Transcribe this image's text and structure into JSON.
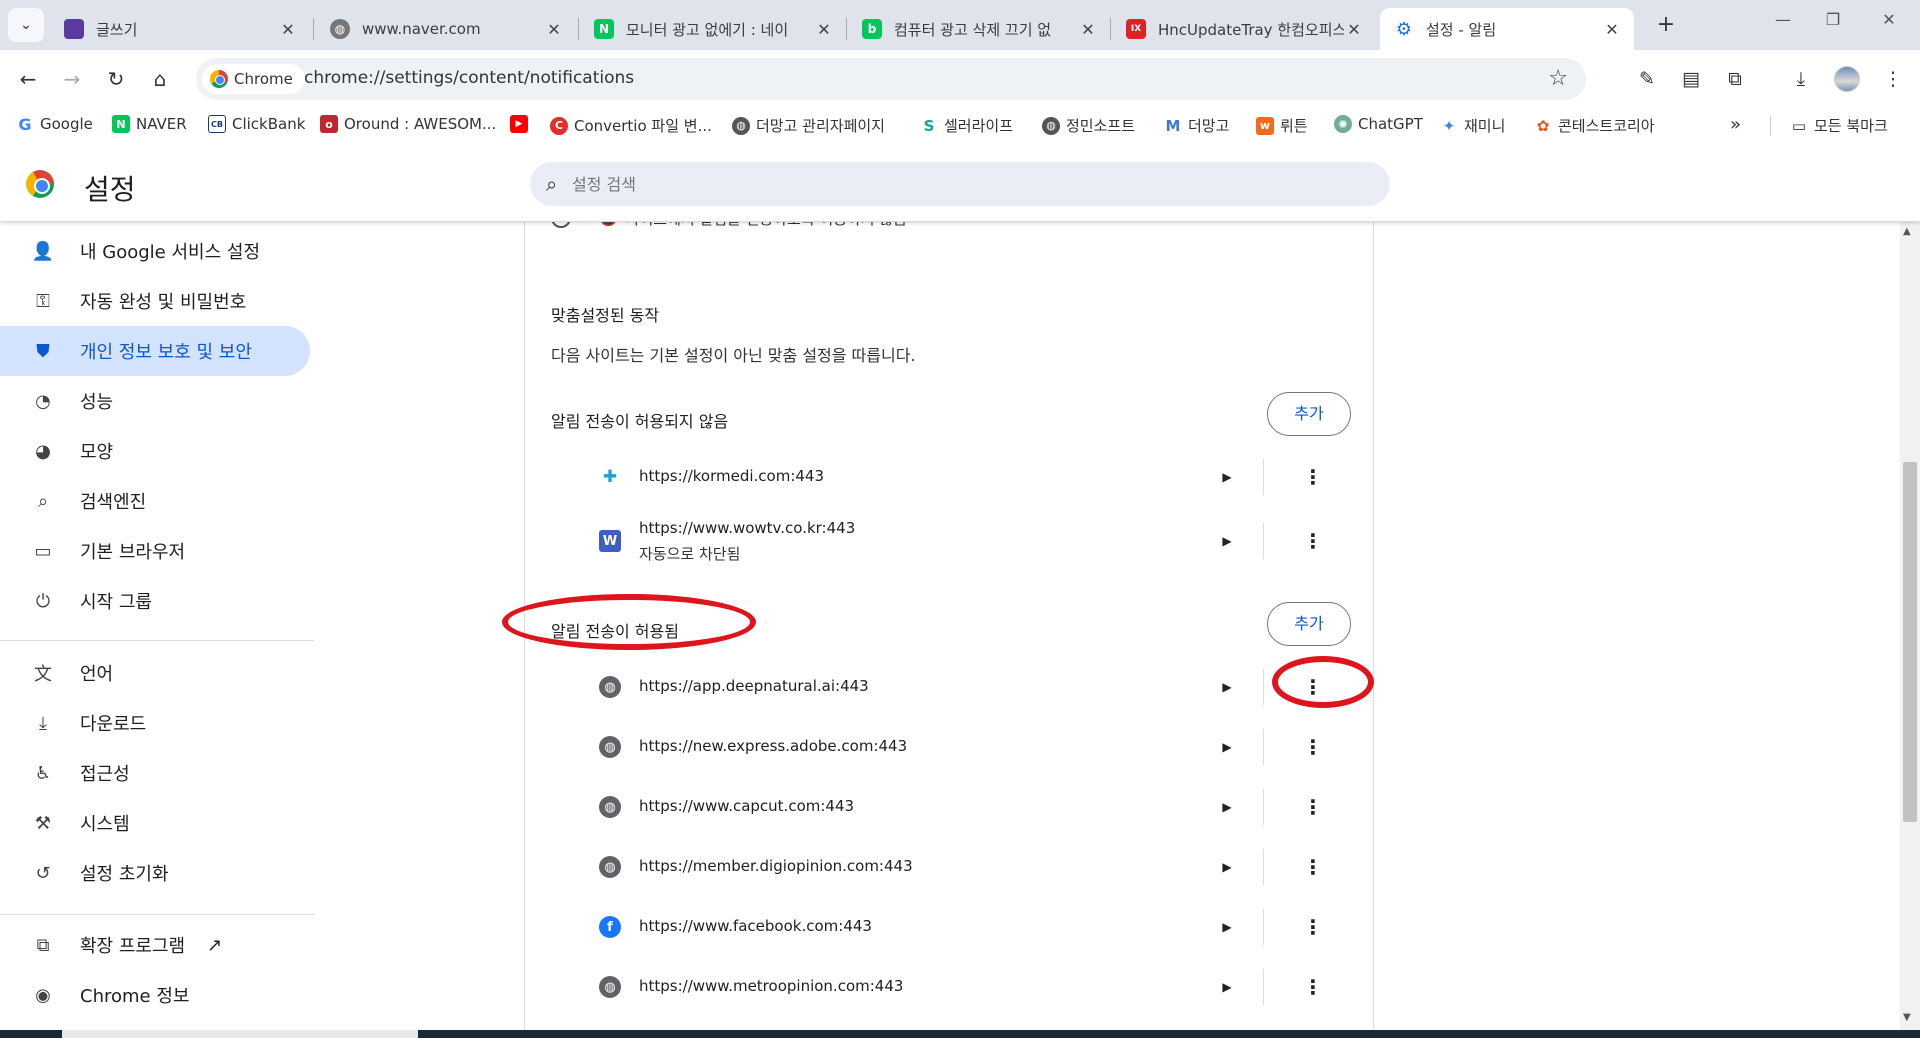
{
  "browser": {
    "tabs": [
      {
        "title": "글쓰기",
        "favicon_color": "#5b3c9e",
        "favicon_glyph": ""
      },
      {
        "title": "www.naver.com",
        "favicon_color": "#777777",
        "favicon_glyph": ""
      },
      {
        "title": "모니터 광고 없에기 : 네이",
        "favicon_color": "#03c75a",
        "favicon_glyph": "N"
      },
      {
        "title": "컴퓨터 광고 삭제 끄기 없",
        "favicon_color": "#03c75a",
        "favicon_glyph": "b"
      },
      {
        "title": "HncUpdateTray 한컴오피스",
        "favicon_color": "#e01f26",
        "favicon_glyph": "IX"
      },
      {
        "title": "설정 - 알림",
        "favicon_color": "#1a73e8",
        "favicon_glyph": "⚙"
      }
    ],
    "active_tab_index": 5,
    "chip_label": "Chrome",
    "url": "chrome://settings/content/notifications",
    "bookmarks": [
      {
        "label": "Google",
        "icon_color": "#ffffff",
        "glyph": "G",
        "glyph_color": "#4285f4"
      },
      {
        "label": "NAVER",
        "icon_color": "#03c75a",
        "glyph": "N",
        "glyph_color": "#ffffff"
      },
      {
        "label": "ClickBank",
        "icon_color": "#ffffff",
        "glyph": "CB",
        "glyph_color": "#1b3a6b"
      },
      {
        "label": "Oround : AWESOM...",
        "icon_color": "#c0272d",
        "glyph": "o",
        "glyph_color": "#ffffff"
      },
      {
        "label": "",
        "icon_color": "#ff0000",
        "glyph": "▶",
        "glyph_color": "#ffffff"
      },
      {
        "label": "Convertio 파일 변...",
        "icon_color": "#e22d28",
        "glyph": "C",
        "glyph_color": "#ffffff"
      },
      {
        "label": "더망고 관리자페이지",
        "icon_color": "#555555",
        "glyph": "◍",
        "glyph_color": "#ffffff"
      },
      {
        "label": "셀러라이프",
        "icon_color": "#ffffff",
        "glyph": "S",
        "glyph_color": "#15a38f"
      },
      {
        "label": "정민소프트",
        "icon_color": "#555555",
        "glyph": "◍",
        "glyph_color": "#ffffff"
      },
      {
        "label": "더망고",
        "icon_color": "#ffffff",
        "glyph": "M",
        "glyph_color": "#3a7bd5"
      },
      {
        "label": "뤼튼",
        "icon_color": "#f26b1d",
        "glyph": "w",
        "glyph_color": "#ffffff"
      },
      {
        "label": "ChatGPT",
        "icon_color": "#74aa9c",
        "glyph": "✺",
        "glyph_color": "#ffffff"
      },
      {
        "label": "재미니",
        "icon_color": "#ffffff",
        "glyph": "✦",
        "glyph_color": "#4a7cf0"
      },
      {
        "label": "콘테스트코리아",
        "icon_color": "#ffffff",
        "glyph": "✿",
        "glyph_color": "#e8521c"
      }
    ],
    "all_bookmarks_label": "모든 북마크"
  },
  "settings": {
    "title": "설정",
    "search_placeholder": "설정 검색",
    "nav": [
      {
        "label": "내 Google 서비스 설정",
        "icon": "person-icon",
        "glyph": "👤"
      },
      {
        "label": "자동 완성 및 비밀번호",
        "icon": "key-icon",
        "glyph": "⚿"
      },
      {
        "label": "개인 정보 보호 및 보안",
        "icon": "shield-icon",
        "glyph": "⛊"
      },
      {
        "label": "성능",
        "icon": "speedometer-icon",
        "glyph": "◔"
      },
      {
        "label": "모양",
        "icon": "palette-icon",
        "glyph": "◕"
      },
      {
        "label": "검색엔진",
        "icon": "search-icon",
        "glyph": "🔍"
      },
      {
        "label": "기본 브라우저",
        "icon": "browser-window-icon",
        "glyph": "▭"
      },
      {
        "label": "시작 그룹",
        "icon": "power-icon",
        "glyph": "⏻"
      },
      {
        "label": "언어",
        "icon": "translate-icon",
        "glyph": "文"
      },
      {
        "label": "다운로드",
        "icon": "download-icon",
        "glyph": "⤓"
      },
      {
        "label": "접근성",
        "icon": "accessibility-icon",
        "glyph": "♿"
      },
      {
        "label": "시스템",
        "icon": "wrench-icon",
        "glyph": "🔧"
      },
      {
        "label": "설정 초기화",
        "icon": "reset-icon",
        "glyph": "↺"
      },
      {
        "label": "확장 프로그램",
        "icon": "extension-icon",
        "glyph": "⧉"
      },
      {
        "label": "Chrome 정보",
        "icon": "chrome-icon",
        "glyph": "◉"
      }
    ],
    "active_nav_index": 2,
    "partial_text": "사이트에서 알림을 전송하도록 허용하지 않음",
    "custom_heading": "맞춤설정된 동작",
    "custom_subtext": "다음 사이트는 기본 설정이 아닌 맞춤 설정을 따릅니다.",
    "add_label": "추가",
    "blocked_heading": "알림 전송이 허용되지 않음",
    "blocked_sites": [
      {
        "url": "https://kormedi.com:443",
        "sub": "",
        "icon": "kormedi-icon",
        "icon_color": "#1fa3d6",
        "glyph": "K"
      },
      {
        "url": "https://www.wowtv.co.kr:443",
        "sub": "자동으로 차단됨",
        "icon": "wowtv-icon",
        "icon_color": "#3d5fc4",
        "glyph": "W"
      }
    ],
    "allowed_heading": "알림 전송이 허용됨",
    "allowed_sites": [
      {
        "url": "https://app.deepnatural.ai:443",
        "icon": "globe-icon",
        "icon_color": "#5f6368",
        "glyph": "◍"
      },
      {
        "url": "https://new.express.adobe.com:443",
        "icon": "globe-icon",
        "icon_color": "#5f6368",
        "glyph": "◍"
      },
      {
        "url": "https://www.capcut.com:443",
        "icon": "globe-icon",
        "icon_color": "#5f6368",
        "glyph": "◍"
      },
      {
        "url": "https://member.digiopinion.com:443",
        "icon": "globe-icon",
        "icon_color": "#5f6368",
        "glyph": "◍"
      },
      {
        "url": "https://www.facebook.com:443",
        "icon": "facebook-icon",
        "icon_color": "#1877f2",
        "glyph": "f"
      },
      {
        "url": "https://www.metroopinion.com:443",
        "icon": "globe-icon",
        "icon_color": "#5f6368",
        "glyph": "◍"
      }
    ]
  },
  "colors": {
    "accent": "#0b57d0",
    "active_nav_bg": "#d3e3fd",
    "annotation_red": "#e0141d"
  }
}
